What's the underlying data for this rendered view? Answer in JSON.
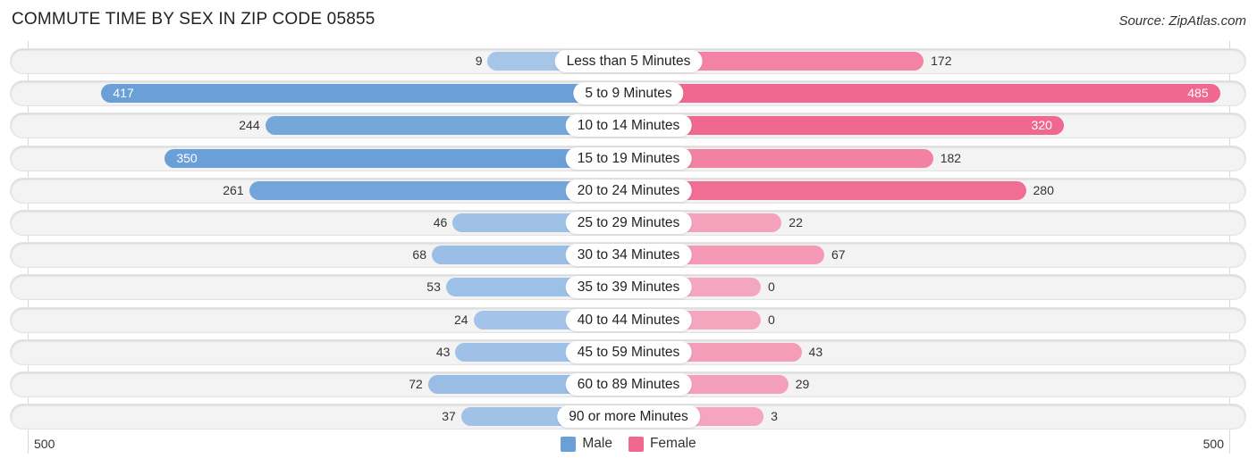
{
  "header": {
    "title": "COMMUTE TIME BY SEX IN ZIP CODE 05855",
    "source": "Source: ZipAtlas.com"
  },
  "colors": {
    "male_strong": "#6a9fd8",
    "male_light": "#a8c7e9",
    "female_strong": "#f06890",
    "female_light": "#f5a6bf"
  },
  "chart_data": {
    "type": "bar",
    "orientation": "horizontal-diverging",
    "title": "COMMUTE TIME BY SEX IN ZIP CODE 05855",
    "categories": [
      "Less than 5 Minutes",
      "5 to 9 Minutes",
      "10 to 14 Minutes",
      "15 to 19 Minutes",
      "20 to 24 Minutes",
      "25 to 29 Minutes",
      "30 to 34 Minutes",
      "35 to 39 Minutes",
      "40 to 44 Minutes",
      "45 to 59 Minutes",
      "60 to 89 Minutes",
      "90 or more Minutes"
    ],
    "series": [
      {
        "name": "Male",
        "values": [
          9,
          417,
          244,
          350,
          261,
          46,
          68,
          53,
          24,
          43,
          72,
          37
        ]
      },
      {
        "name": "Female",
        "values": [
          172,
          485,
          320,
          182,
          280,
          22,
          67,
          0,
          0,
          43,
          29,
          3
        ]
      }
    ],
    "axis": {
      "left_label": "500",
      "right_label": "500",
      "max": 500
    },
    "legend": {
      "position": "bottom-center",
      "entries": [
        "Male",
        "Female"
      ]
    },
    "inside_label_threshold": 300
  }
}
